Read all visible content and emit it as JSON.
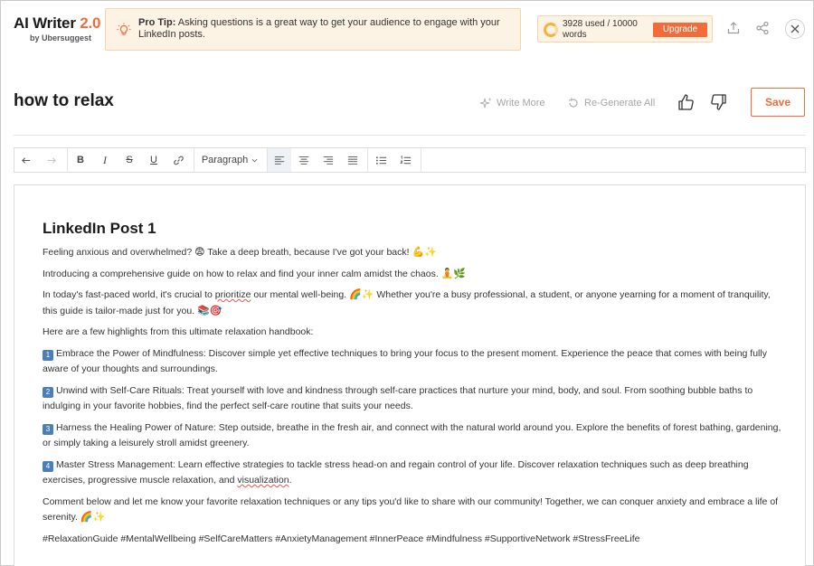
{
  "brand": {
    "title": "AI Writer",
    "version": "2.0",
    "subtitle": "by Ubersuggest"
  },
  "protip": {
    "label": "Pro Tip:",
    "text": " Asking questions is a great way to get your audience to engage with your LinkedIn posts."
  },
  "usage": {
    "text": "3928 used / 10000 words",
    "used": 3928,
    "total": 10000,
    "upgrade_label": "Upgrade"
  },
  "header": {
    "title": "how to relax",
    "write_more_label": "Write More",
    "regenerate_label": "Re-Generate All",
    "save_label": "Save"
  },
  "toolbar": {
    "paragraph_label": "Paragraph"
  },
  "post": {
    "title": "LinkedIn Post 1",
    "p1_text": "Feeling anxious and overwhelmed? ",
    "p1_emoji1": "😨",
    "p1_text2": " Take a deep breath, because I've got your back! ",
    "p1_emoji2": "💪✨",
    "p2_text": "Introducing a comprehensive guide on how to relax and find your inner calm amidst the chaos. ",
    "p2_emoji": "🧘🌿",
    "p3_text_a": "In today's fast-paced world, it's crucial to ",
    "p3_squig": "prioritize",
    "p3_text_b": " our mental well-being. ",
    "p3_emoji1": "🌈✨",
    "p3_text_c": " Whether you're a busy professional, a student, or anyone yearning for a moment of tranquility, this guide is tailor-made just for you. ",
    "p3_emoji2": "📚🎯",
    "p4_text": "Here are a few highlights from this ultimate relaxation handbook:",
    "items": [
      {
        "num": "1",
        "text": "Embrace the Power of Mindfulness: Discover simple yet effective techniques to bring your focus to the present moment. Experience the peace that comes with being fully aware of your thoughts and surroundings."
      },
      {
        "num": "2",
        "text": "Unwind with Self-Care Rituals: Treat yourself with love and kindness through self-care practices that nurture your mind, body, and soul. From soothing bubble baths to indulging in your favorite hobbies, find the perfect self-care routine that suits your needs."
      },
      {
        "num": "3",
        "text": "Harness the Healing Power of Nature: Step outside, breathe in the fresh air, and connect with the natural world around you. Explore the benefits of forest bathing, gardening, or simply taking a leisurely stroll amidst greenery."
      },
      {
        "num": "4",
        "text_a": "Master Stress Management: Learn effective strategies to tackle stress head-on and regain control of your life. Discover relaxation techniques such as deep breathing exercises, progressive muscle relaxation, and ",
        "squig": "visualization",
        "text_b": "."
      }
    ],
    "p_final": "Comment below and let me know your favorite relaxation techniques or any tips you'd like to share with our community! Together, we can conquer anxiety and embrace a life of serenity. ",
    "p_final_emoji": "🌈✨",
    "hashtags": "#RelaxationGuide #MentalWellbeing #SelfCareMatters #AnxietyManagement #InnerPeace #Mindfulness #SupportiveNetwork #StressFreeLife"
  },
  "colors": {
    "accent": "#f26b38",
    "tip_bg": "#fdf3e4",
    "tip_border": "#f5d6ac"
  }
}
